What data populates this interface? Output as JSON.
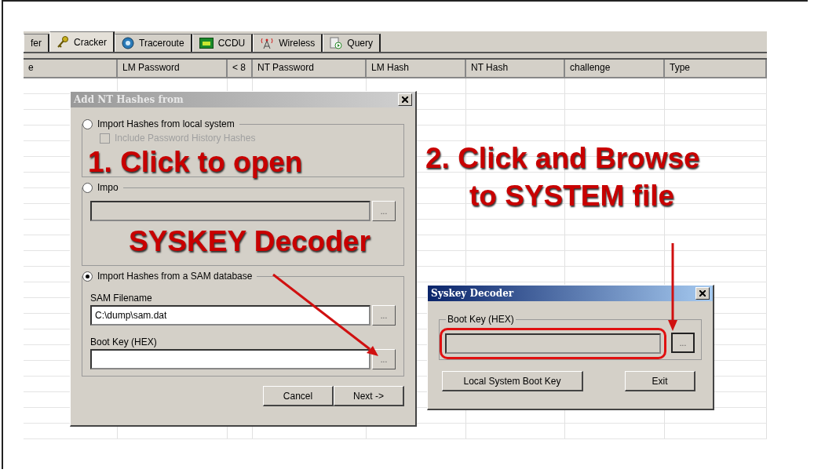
{
  "tabs": [
    {
      "label": "fer",
      "selected": false
    },
    {
      "label": "Cracker",
      "selected": true
    },
    {
      "label": "Traceroute",
      "selected": false
    },
    {
      "label": "CCDU",
      "selected": false
    },
    {
      "label": "Wireless",
      "selected": false
    },
    {
      "label": "Query",
      "selected": false
    }
  ],
  "table": {
    "columns": [
      "e",
      "LM Password",
      "< 8",
      "NT Password",
      "LM Hash",
      "NT Hash",
      "challenge",
      "Type"
    ]
  },
  "add_dialog": {
    "title": "Add NT Hashes from",
    "sources": [
      {
        "kind": "local",
        "label": "Import Hashes from local system",
        "selected": false,
        "checkbox": {
          "label": "Include Password History Hashes",
          "checked": false,
          "disabled": true
        }
      },
      {
        "kind": "text",
        "label": "Impo",
        "selected": false,
        "browse": "..."
      },
      {
        "kind": "sam",
        "label": "Import Hashes from a SAM database",
        "selected": true,
        "fields": [
          {
            "label": "SAM Filename",
            "value": "C:\\dump\\sam.dat",
            "browse": "..."
          },
          {
            "label": "Boot Key (HEX)",
            "browse": "..."
          }
        ]
      }
    ],
    "buttons": [
      "Cancel",
      "Next ->"
    ]
  },
  "syskey_dialog": {
    "title": "Syskey Decoder",
    "group_label": "Boot Key (HEX)",
    "browse": "...",
    "buttons": [
      "Local System Boot Key",
      "Exit"
    ]
  },
  "annotations": [
    {
      "lines": [
        "1. Click to open",
        "SYSKEY Decoder"
      ]
    },
    {
      "lines": [
        "2. Click and Browse",
        "to SYSTEM file"
      ]
    }
  ]
}
